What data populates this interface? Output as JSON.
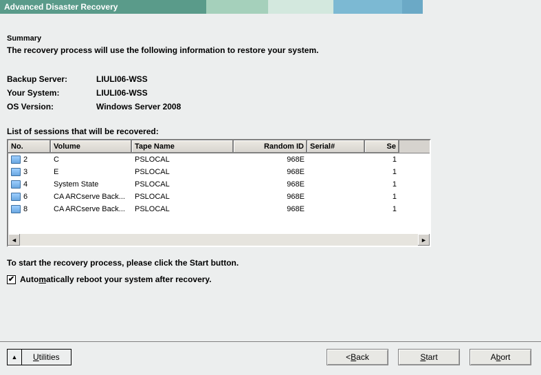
{
  "titlebar": {
    "title": "Advanced Disaster Recovery"
  },
  "summary": {
    "heading": "Summary",
    "text": "The recovery process will use the following information to restore your system."
  },
  "info": {
    "backup_server_label": "Backup Server:",
    "backup_server_value": "LIULI06-WSS",
    "your_system_label": "Your System:",
    "your_system_value": "LIULI06-WSS",
    "os_version_label": "OS Version:",
    "os_version_value": "Windows Server 2008"
  },
  "sessions": {
    "title": "List of sessions that will be recovered:",
    "columns": {
      "no": "No.",
      "volume": "Volume",
      "tape": "Tape Name",
      "rid": "Random ID",
      "serial": "Serial#",
      "se": "Se"
    },
    "rows": [
      {
        "no": "2",
        "volume": "C",
        "tape": "PSLOCAL",
        "rid": "968E",
        "serial": "",
        "se": "1"
      },
      {
        "no": "3",
        "volume": "E",
        "tape": "PSLOCAL",
        "rid": "968E",
        "serial": "",
        "se": "1"
      },
      {
        "no": "4",
        "volume": "System State",
        "tape": "PSLOCAL",
        "rid": "968E",
        "serial": "",
        "se": "1"
      },
      {
        "no": "6",
        "volume": "CA ARCserve Back...",
        "tape": "PSLOCAL",
        "rid": "968E",
        "serial": "",
        "se": "1"
      },
      {
        "no": "8",
        "volume": "CA ARCserve Back...",
        "tape": "PSLOCAL",
        "rid": "968E",
        "serial": "",
        "se": "1"
      }
    ]
  },
  "instruction": "To start the recovery process, please click the Start button.",
  "checkbox": {
    "checked": true,
    "pre": "Auto",
    "ukey": "m",
    "post": "atically reboot your system after recovery."
  },
  "footer": {
    "utilities_u": "U",
    "utilities_rest": "tilities",
    "back_pre": "< ",
    "back_u": "B",
    "back_post": "ack",
    "start_u": "S",
    "start_post": "tart",
    "abort_pre": "A",
    "abort_u": "b",
    "abort_post": "ort"
  }
}
